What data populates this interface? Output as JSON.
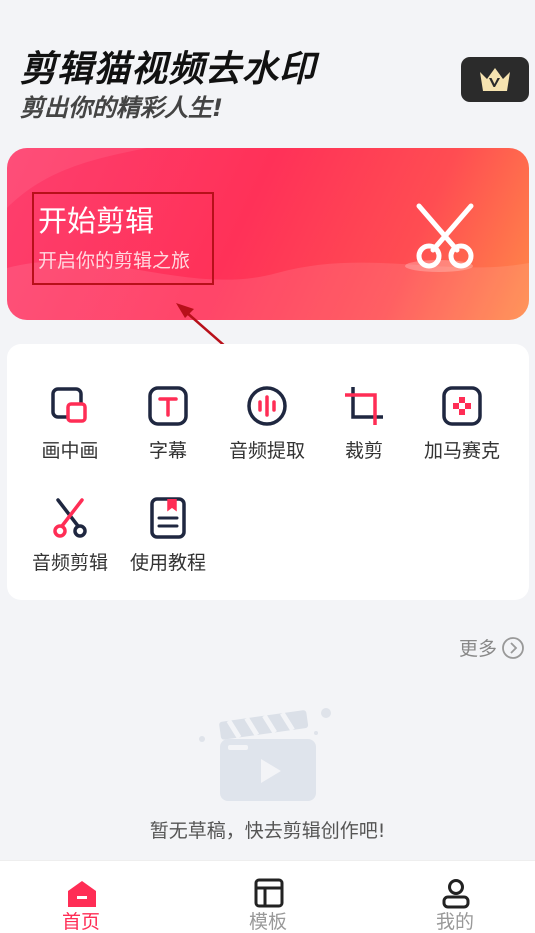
{
  "header": {
    "title": "剪辑猫视频去水印",
    "subtitle": "剪出你的精彩人生!",
    "vip_icon": "crown-icon"
  },
  "hero": {
    "title": "开始剪辑",
    "subtitle": "开启你的剪辑之旅",
    "icon": "scissors-icon"
  },
  "tools": [
    {
      "label": "画中画",
      "icon": "pip-icon"
    },
    {
      "label": "字幕",
      "icon": "text-icon"
    },
    {
      "label": "音频提取",
      "icon": "audio-wave-icon"
    },
    {
      "label": "裁剪",
      "icon": "crop-icon"
    },
    {
      "label": "加马赛克",
      "icon": "mosaic-icon"
    },
    {
      "label": "音频剪辑",
      "icon": "scissors-icon"
    },
    {
      "label": "使用教程",
      "icon": "tutorial-icon"
    }
  ],
  "more": {
    "label": "更多",
    "icon": "chevron-right-icon"
  },
  "empty": {
    "text": "暂无草稿，快去剪辑创作吧!",
    "icon": "clapperboard-icon"
  },
  "nav": [
    {
      "label": "首页",
      "icon": "home-icon",
      "active": true
    },
    {
      "label": "模板",
      "icon": "template-icon",
      "active": false
    },
    {
      "label": "我的",
      "icon": "profile-icon",
      "active": false
    }
  ],
  "colors": {
    "accent": "#ff2d55",
    "hero_start": "#fe3f6e",
    "hero_end": "#ff8a48",
    "annotation": "#b8101a"
  }
}
